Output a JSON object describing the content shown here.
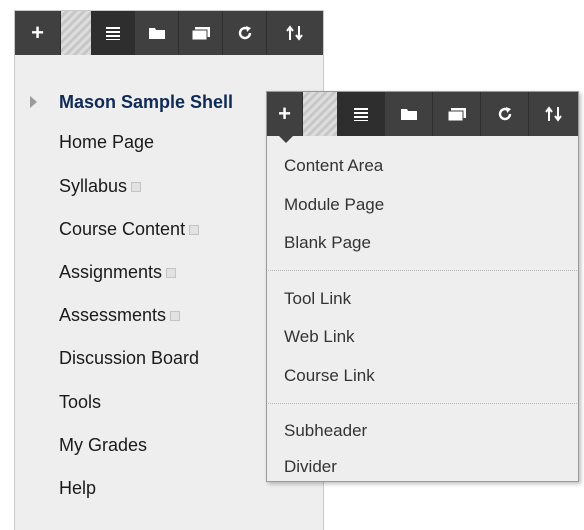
{
  "toolbar": {
    "add_label": "+",
    "buttons": [
      "add",
      "list-view",
      "folder",
      "window",
      "refresh",
      "sort"
    ]
  },
  "menu": {
    "title": "Mason Sample Shell",
    "items": [
      {
        "label": "Home Page",
        "hidden": false
      },
      {
        "label": "Syllabus",
        "hidden": true
      },
      {
        "label": "Course Content",
        "hidden": true
      },
      {
        "label": "Assignments",
        "hidden": true
      },
      {
        "label": "Assessments",
        "hidden": true
      },
      {
        "label": "Discussion Board",
        "hidden": false
      },
      {
        "label": "Tools",
        "hidden": false
      },
      {
        "label": "My Grades",
        "hidden": false
      },
      {
        "label": "Help",
        "hidden": false
      }
    ]
  },
  "dropdown": {
    "group1": [
      "Content Area",
      "Module Page",
      "Blank Page"
    ],
    "group2": [
      "Tool Link",
      "Web Link",
      "Course Link"
    ],
    "group3": [
      "Subheader",
      "Divider"
    ]
  },
  "colors": {
    "toolbar_bg": "#404040",
    "panel_bg": "#eeeeee",
    "title_color": "#0f2a55"
  }
}
